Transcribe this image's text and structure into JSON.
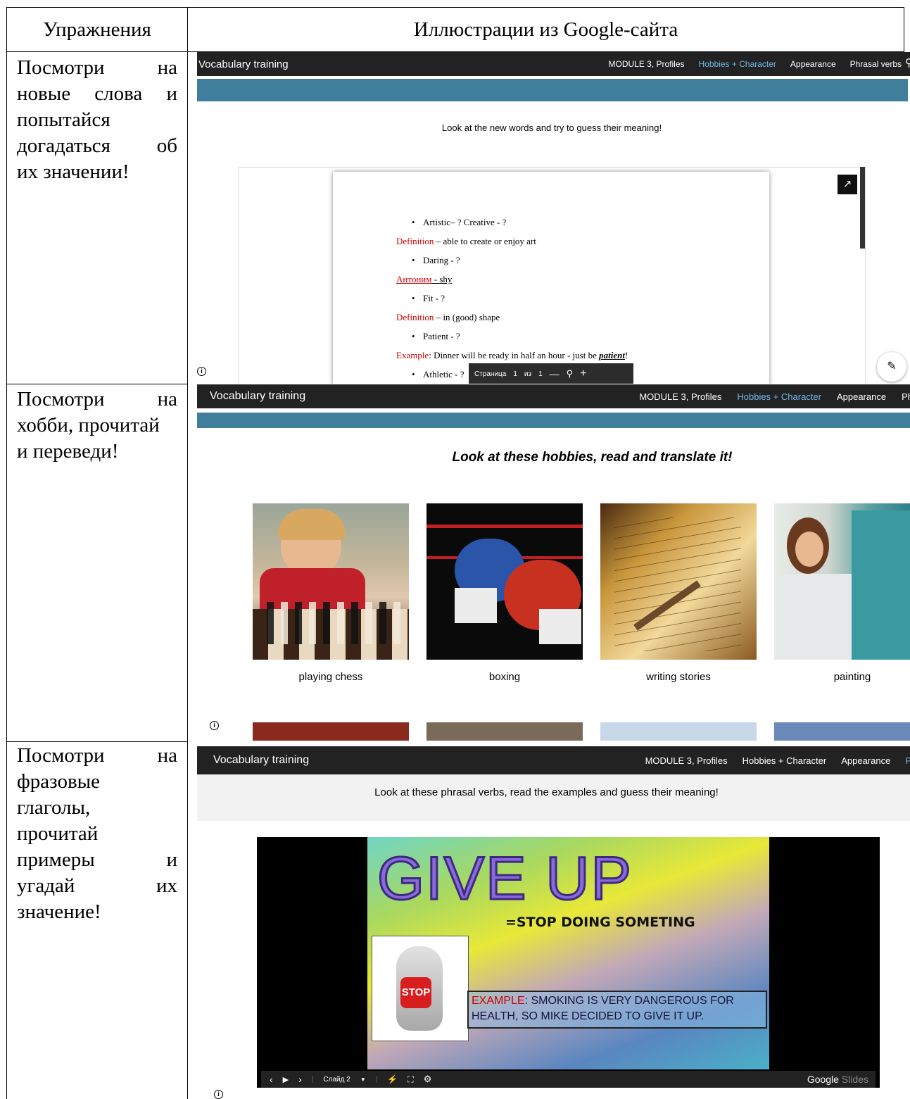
{
  "table": {
    "headers": {
      "col1": "Упражнения",
      "col2": "Иллюстрации из Google-сайта"
    },
    "rows": [
      {
        "task_lines": [
          "Посмотри на",
          "новые слова и",
          "попытайся",
          "догадаться об",
          "их значении!"
        ]
      },
      {
        "task_lines": [
          "Посмотри на",
          "хобби, прочитай",
          "и переведи!"
        ]
      },
      {
        "task_lines": [
          "Посмотри на",
          "фразовые",
          "глаголы,",
          "прочитай",
          "примеры и",
          "угадай их",
          "значение!"
        ]
      }
    ]
  },
  "site": {
    "brand": "Vocabulary training",
    "nav": [
      "MODULE 3, Profiles",
      "Hobbies + Character",
      "Appearance",
      "Phrasal verbs"
    ],
    "colors": {
      "topbar": "#222222",
      "accent_bar": "#3f7f9b",
      "active_nav": "#74b6e8",
      "red_text": "#cc0000"
    }
  },
  "panel1": {
    "nav_visible": [
      "MODULE 3, Profiles",
      "Hobbies + Character",
      "Appearance",
      "Phrasal verbs"
    ],
    "intro": "Look at the new words and try to guess their meaning!",
    "doc": {
      "l1": "Artistic– ?  Creative - ?",
      "l2a": "Definition",
      "l2b": " – able to create or enjoy art",
      "l3": "Daring - ?",
      "l4a": "Антоним",
      "l4b": " - shy",
      "l5": "Fit - ?",
      "l6a": "Definition",
      "l6b": " – in (good) shape",
      "l7": "Patient - ?",
      "l8a": "Example",
      "l8b": ": Dinner will be ready in half an hour - just be ",
      "l8c": "patient",
      "l8d": "!",
      "l9": "Athletic - ?"
    },
    "pager": {
      "label": "Страница",
      "current": "1",
      "of": "из",
      "total": "1",
      "minus": "—",
      "plus": "+"
    },
    "icons": [
      "open-in-new-icon",
      "info-icon",
      "edit-icon",
      "zoom-icon"
    ]
  },
  "panel2": {
    "nav_visible": [
      "MODULE 3, Profiles",
      "Hobbies + Character",
      "Appearance",
      "Ph"
    ],
    "intro": "Look at these hobbies, read and translate it!",
    "hobbies": [
      "playing chess",
      "boxing",
      "writing stories",
      "painting"
    ]
  },
  "panel3": {
    "nav_visible": [
      "MODULE 3, Profiles",
      "Hobbies + Character",
      "Appearance",
      "P"
    ],
    "intro": "Look at these phrasal verbs, read the examples and guess their meaning!",
    "slide": {
      "title": "GIVE UP",
      "meaning": "=STOP DOING SOMETING",
      "stop_sign": "STOP",
      "example_label": "EXAMPLE",
      "example_text": ": SMOKING IS VERY DANGEROUS FOR HEALTH, SO MIKE DECIDED TO GIVE IT UP."
    },
    "controls": {
      "slide_label": "Слайд 2",
      "brand_a": "Google",
      "brand_b": " Slides"
    }
  }
}
